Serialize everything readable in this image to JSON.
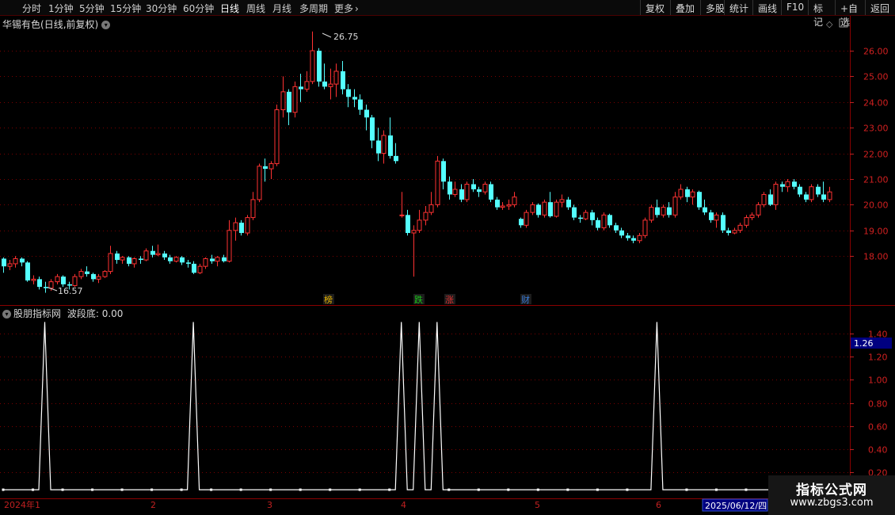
{
  "toolbar": {
    "periods": [
      "分时",
      "1分钟",
      "5分钟",
      "15分钟",
      "30分钟",
      "60分钟",
      "日线",
      "周线",
      "月线",
      "多周期",
      "更多"
    ],
    "active_period": "日线",
    "right_buttons": [
      "复权",
      "叠加",
      "多股",
      "统计",
      "画线",
      "F10",
      "标记",
      "+自选",
      "返回"
    ]
  },
  "main_chart": {
    "stock_name": "华锡有色",
    "mode": "(日线,前复权)",
    "price_axis": [
      "26.00",
      "25.00",
      "24.00",
      "23.00",
      "22.00",
      "21.00",
      "20.00",
      "19.00",
      "18.00"
    ],
    "high_label": "26.75",
    "low_label": "16.57",
    "event_markers": [
      {
        "text": "榜",
        "color": "#e6b400"
      },
      {
        "text": "跌",
        "color": "#19c619"
      },
      {
        "text": "涨",
        "color": "#e03030"
      },
      {
        "text": "财",
        "color": "#3a7bd5"
      }
    ]
  },
  "indicator": {
    "name": "股朋指标网",
    "line_name": "波段底",
    "line_value": "0.00",
    "axis": [
      "1.40",
      "1.20",
      "1.00",
      "0.80",
      "0.60",
      "0.40",
      "0.20"
    ],
    "current_value": "1.26"
  },
  "date_axis": {
    "labels": [
      "2024年1",
      "2",
      "3",
      "4",
      "5",
      "6"
    ],
    "cursor_date": "2025/06/12/四"
  },
  "watermark": {
    "title": "指标公式网",
    "url": "www.zbgs3.com"
  },
  "colors": {
    "up": "#ff3232",
    "down": "#54ffff",
    "grid": "#7a0000",
    "indicator_line": "#ffffff",
    "cursor_box": "#000080"
  },
  "chart_data": {
    "type": "candlestick",
    "ohlc": [
      [
        17.9,
        17.95,
        17.35,
        17.6
      ],
      [
        17.6,
        17.85,
        17.45,
        17.7
      ],
      [
        17.7,
        18.0,
        17.55,
        17.9
      ],
      [
        17.9,
        17.95,
        17.6,
        17.75
      ],
      [
        17.75,
        17.8,
        17.0,
        17.05
      ],
      [
        17.05,
        17.25,
        16.9,
        17.1
      ],
      [
        17.1,
        17.2,
        16.7,
        16.8
      ],
      [
        16.8,
        17.0,
        16.57,
        16.75
      ],
      [
        16.75,
        17.1,
        16.65,
        17.0
      ],
      [
        17.0,
        17.3,
        16.9,
        17.2
      ],
      [
        17.2,
        17.25,
        16.8,
        16.9
      ],
      [
        16.9,
        17.0,
        16.7,
        16.85
      ],
      [
        16.85,
        17.3,
        16.8,
        17.2
      ],
      [
        17.2,
        17.5,
        17.1,
        17.4
      ],
      [
        17.4,
        17.6,
        17.2,
        17.3
      ],
      [
        17.3,
        17.35,
        17.0,
        17.1
      ],
      [
        17.1,
        17.3,
        16.95,
        17.2
      ],
      [
        17.2,
        17.45,
        17.15,
        17.4
      ],
      [
        17.4,
        18.4,
        17.3,
        18.1
      ],
      [
        18.1,
        18.2,
        17.7,
        17.85
      ],
      [
        17.85,
        18.0,
        17.7,
        17.95
      ],
      [
        17.95,
        18.0,
        17.6,
        17.7
      ],
      [
        17.7,
        17.95,
        17.55,
        17.9
      ],
      [
        17.9,
        18.0,
        17.7,
        17.85
      ],
      [
        17.85,
        18.3,
        17.8,
        18.2
      ],
      [
        18.2,
        18.4,
        17.95,
        18.05
      ],
      [
        18.05,
        18.45,
        18.0,
        18.1
      ],
      [
        18.1,
        18.2,
        17.85,
        17.95
      ],
      [
        17.95,
        18.05,
        17.7,
        17.8
      ],
      [
        17.8,
        18.0,
        17.75,
        17.95
      ],
      [
        17.95,
        18.0,
        17.65,
        17.75
      ],
      [
        17.75,
        17.85,
        17.55,
        17.7
      ],
      [
        17.7,
        17.8,
        17.3,
        17.35
      ],
      [
        17.35,
        17.7,
        17.3,
        17.6
      ],
      [
        17.6,
        17.95,
        17.5,
        17.9
      ],
      [
        17.9,
        18.05,
        17.7,
        17.8
      ],
      [
        17.8,
        18.0,
        17.6,
        17.95
      ],
      [
        17.95,
        18.05,
        17.75,
        17.8
      ],
      [
        17.8,
        19.4,
        17.75,
        19.0
      ],
      [
        19.0,
        19.5,
        18.6,
        19.3
      ],
      [
        19.3,
        19.4,
        18.8,
        18.9
      ],
      [
        18.9,
        19.6,
        18.8,
        19.5
      ],
      [
        19.5,
        20.5,
        19.4,
        20.2
      ],
      [
        20.2,
        21.6,
        20.1,
        21.5
      ],
      [
        21.5,
        21.8,
        20.9,
        21.4
      ],
      [
        21.4,
        21.7,
        21.0,
        21.6
      ],
      [
        21.6,
        23.9,
        21.5,
        23.7
      ],
      [
        23.7,
        25.0,
        23.4,
        24.4
      ],
      [
        24.4,
        24.5,
        23.1,
        23.6
      ],
      [
        23.6,
        24.8,
        23.4,
        24.6
      ],
      [
        24.6,
        25.1,
        24.0,
        24.5
      ],
      [
        24.5,
        25.2,
        24.4,
        24.8
      ],
      [
        24.8,
        26.75,
        24.7,
        26.0
      ],
      [
        26.0,
        26.1,
        24.6,
        24.8
      ],
      [
        24.8,
        25.5,
        24.5,
        24.6
      ],
      [
        24.6,
        25.3,
        24.1,
        24.7
      ],
      [
        24.7,
        25.5,
        24.2,
        25.2
      ],
      [
        25.2,
        25.6,
        24.3,
        24.5
      ],
      [
        24.5,
        24.7,
        23.8,
        24.2
      ],
      [
        24.2,
        24.5,
        23.8,
        24.1
      ],
      [
        24.1,
        24.3,
        23.5,
        23.7
      ],
      [
        23.7,
        23.9,
        22.9,
        23.4
      ],
      [
        23.4,
        23.5,
        22.2,
        22.5
      ],
      [
        22.5,
        23.0,
        21.7,
        22.0
      ],
      [
        22.0,
        22.9,
        21.6,
        22.7
      ],
      [
        22.7,
        23.4,
        21.8,
        21.9
      ],
      [
        21.9,
        22.4,
        21.6,
        21.7
      ],
      [
        19.6,
        20.5,
        19.5,
        19.6
      ],
      [
        19.6,
        19.8,
        18.8,
        18.9
      ],
      [
        18.9,
        19.2,
        17.2,
        19.0
      ],
      [
        19.0,
        19.8,
        18.9,
        19.4
      ],
      [
        19.4,
        19.95,
        19.2,
        19.7
      ],
      [
        19.7,
        20.5,
        19.6,
        20.0
      ],
      [
        20.0,
        21.9,
        19.9,
        21.7
      ],
      [
        21.7,
        21.8,
        20.6,
        20.9
      ],
      [
        20.9,
        21.1,
        20.2,
        20.4
      ],
      [
        20.4,
        20.9,
        20.3,
        20.6
      ],
      [
        20.6,
        20.8,
        20.1,
        20.2
      ],
      [
        20.2,
        20.9,
        20.1,
        20.8
      ],
      [
        20.8,
        21.0,
        20.5,
        20.6
      ],
      [
        20.6,
        20.7,
        20.3,
        20.5
      ],
      [
        20.5,
        20.9,
        20.4,
        20.8
      ],
      [
        20.8,
        20.9,
        20.1,
        20.2
      ],
      [
        20.2,
        20.3,
        19.8,
        19.9
      ],
      [
        19.9,
        20.1,
        19.8,
        19.95
      ],
      [
        19.95,
        20.2,
        19.8,
        20.0
      ],
      [
        20.0,
        20.5,
        19.9,
        20.3
      ],
      [
        19.45,
        19.5,
        19.1,
        19.2
      ],
      [
        19.2,
        19.8,
        19.1,
        19.7
      ],
      [
        19.7,
        20.1,
        19.6,
        20.0
      ],
      [
        20.0,
        20.05,
        19.5,
        19.6
      ],
      [
        19.6,
        20.2,
        19.5,
        20.1
      ],
      [
        20.1,
        20.5,
        19.5,
        19.55
      ],
      [
        19.55,
        20.2,
        19.5,
        20.1
      ],
      [
        20.1,
        20.4,
        19.9,
        20.2
      ],
      [
        20.2,
        20.3,
        19.8,
        19.9
      ],
      [
        19.9,
        20.0,
        19.4,
        19.5
      ],
      [
        19.5,
        19.6,
        19.3,
        19.45
      ],
      [
        19.45,
        19.8,
        19.4,
        19.7
      ],
      [
        19.7,
        19.8,
        19.2,
        19.4
      ],
      [
        19.4,
        19.5,
        19.0,
        19.1
      ],
      [
        19.1,
        19.7,
        19.0,
        19.6
      ],
      [
        19.6,
        19.65,
        19.1,
        19.2
      ],
      [
        19.2,
        19.3,
        18.9,
        19.0
      ],
      [
        19.0,
        19.1,
        18.7,
        18.8
      ],
      [
        18.8,
        18.9,
        18.6,
        18.7
      ],
      [
        18.7,
        18.8,
        18.5,
        18.6
      ],
      [
        18.6,
        18.9,
        18.5,
        18.8
      ],
      [
        18.8,
        19.5,
        18.7,
        19.4
      ],
      [
        19.4,
        20.0,
        19.3,
        19.9
      ],
      [
        19.9,
        20.2,
        19.5,
        19.6
      ],
      [
        19.6,
        20.0,
        19.5,
        19.9
      ],
      [
        19.9,
        20.1,
        19.5,
        19.6
      ],
      [
        19.6,
        20.5,
        19.5,
        20.3
      ],
      [
        20.3,
        20.8,
        20.2,
        20.6
      ],
      [
        20.6,
        20.7,
        20.1,
        20.3
      ],
      [
        20.3,
        20.6,
        20.0,
        20.5
      ],
      [
        20.5,
        20.55,
        19.8,
        19.9
      ],
      [
        19.9,
        20.2,
        19.6,
        19.7
      ],
      [
        19.7,
        19.8,
        19.3,
        19.4
      ],
      [
        19.4,
        19.7,
        19.1,
        19.6
      ],
      [
        19.6,
        19.7,
        18.9,
        19.0
      ],
      [
        19.0,
        19.1,
        18.8,
        18.9
      ],
      [
        18.9,
        19.1,
        18.85,
        19.0
      ],
      [
        19.0,
        19.3,
        18.9,
        19.2
      ],
      [
        19.2,
        19.6,
        19.1,
        19.5
      ],
      [
        19.5,
        19.7,
        19.4,
        19.6
      ],
      [
        19.6,
        20.1,
        19.5,
        20.0
      ],
      [
        20.0,
        20.5,
        19.9,
        20.4
      ],
      [
        20.4,
        20.6,
        19.95,
        20.0
      ],
      [
        20.0,
        20.9,
        19.8,
        20.8
      ],
      [
        20.8,
        20.9,
        20.5,
        20.7
      ],
      [
        20.7,
        21.0,
        20.5,
        20.9
      ],
      [
        20.9,
        21.0,
        20.6,
        20.7
      ],
      [
        20.7,
        20.8,
        20.3,
        20.4
      ],
      [
        20.4,
        20.5,
        20.1,
        20.2
      ],
      [
        20.2,
        20.8,
        20.1,
        20.7
      ],
      [
        20.7,
        20.8,
        20.3,
        20.4
      ],
      [
        20.4,
        20.9,
        20.1,
        20.2
      ],
      [
        20.2,
        20.7,
        20.1,
        20.5
      ]
    ],
    "indicator_values": [
      0.05,
      0.05,
      0.05,
      0.05,
      0.05,
      0.05,
      0.05,
      1.5,
      0.05,
      0.05,
      0.05,
      0.05,
      0.05,
      0.05,
      0.05,
      0.05,
      0.05,
      0.05,
      0.05,
      0.05,
      0.05,
      0.05,
      0.05,
      0.05,
      0.05,
      0.05,
      0.05,
      0.05,
      0.05,
      0.05,
      0.05,
      0.05,
      1.5,
      0.05,
      0.05,
      0.05,
      0.05,
      0.05,
      0.05,
      0.05,
      0.05,
      0.05,
      0.05,
      0.05,
      0.05,
      0.05,
      0.05,
      0.05,
      0.05,
      0.05,
      0.05,
      0.05,
      0.05,
      0.05,
      0.05,
      0.05,
      0.05,
      0.05,
      0.05,
      0.05,
      0.05,
      0.05,
      0.05,
      0.05,
      0.05,
      0.05,
      0.05,
      1.5,
      0.05,
      0.05,
      1.5,
      0.05,
      0.05,
      1.5,
      0.05,
      0.05,
      0.05,
      0.05,
      0.05,
      0.05,
      0.05,
      0.05,
      0.05,
      0.05,
      0.05,
      0.05,
      0.05,
      0.05,
      0.05,
      0.05,
      0.05,
      0.05,
      0.05,
      0.05,
      0.05,
      0.05,
      0.05,
      0.05,
      0.05,
      0.05,
      0.05,
      0.05,
      0.05,
      0.05,
      0.05,
      0.05,
      0.05,
      0.05,
      0.05,
      0.05,
      1.5,
      0.05,
      0.05,
      0.05,
      0.05,
      0.05,
      0.05,
      0.05,
      0.05,
      0.05,
      0.05,
      0.05,
      0.05,
      0.05,
      0.05,
      0.05,
      0.05,
      0.05,
      0.05,
      0.05,
      0.05,
      0.05,
      0.05,
      0.05,
      0.05,
      0.05,
      0.05,
      0.05,
      0.05,
      0.05
    ]
  }
}
